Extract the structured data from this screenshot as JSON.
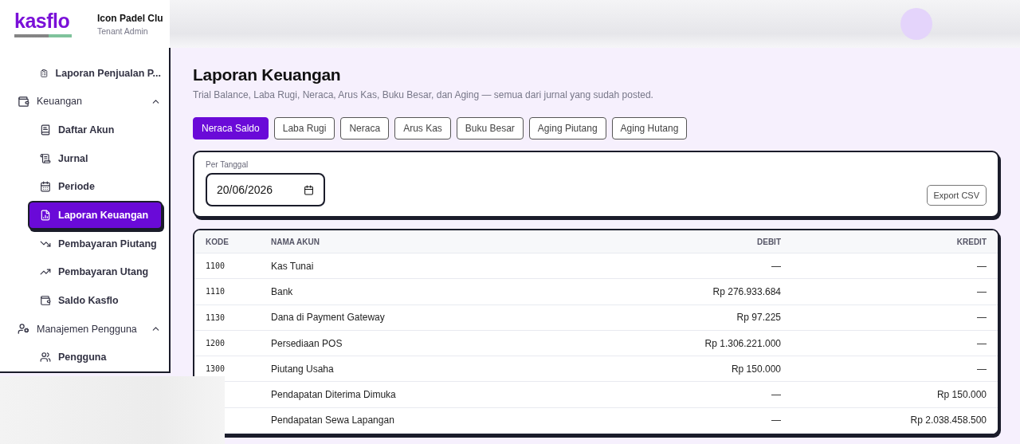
{
  "header": {
    "logo": "kasflo",
    "tenant_name": "Icon Padel Clu",
    "role": "Tenant Admin"
  },
  "sidebar": {
    "items": [
      {
        "kind": "item",
        "label": "Laporan Penjualan P...",
        "selected": false
      },
      {
        "kind": "group",
        "label": "Keuangan",
        "expanded": true
      },
      {
        "kind": "item",
        "label": "Daftar Akun",
        "selected": false
      },
      {
        "kind": "item",
        "label": "Jurnal",
        "selected": false
      },
      {
        "kind": "item",
        "label": "Periode",
        "selected": false
      },
      {
        "kind": "item",
        "label": "Laporan Keuangan",
        "selected": true
      },
      {
        "kind": "item",
        "label": "Pembayaran Piutang",
        "selected": false
      },
      {
        "kind": "item",
        "label": "Pembayaran Utang",
        "selected": false
      },
      {
        "kind": "item",
        "label": "Saldo Kasflo",
        "selected": false
      },
      {
        "kind": "group",
        "label": "Manajemen Pengguna",
        "expanded": true
      },
      {
        "kind": "item",
        "label": "Pengguna",
        "selected": false
      }
    ]
  },
  "page": {
    "title": "Laporan Keuangan",
    "subtitle": "Trial Balance, Laba Rugi, Neraca, Arus Kas, Buku Besar, dan Aging — semua dari jurnal yang sudah posted."
  },
  "tabs": [
    {
      "label": "Neraca Saldo",
      "selected": true
    },
    {
      "label": "Laba Rugi",
      "selected": false
    },
    {
      "label": "Neraca",
      "selected": false
    },
    {
      "label": "Arus Kas",
      "selected": false
    },
    {
      "label": "Buku Besar",
      "selected": false
    },
    {
      "label": "Aging Piutang",
      "selected": false
    },
    {
      "label": "Aging Hutang",
      "selected": false
    }
  ],
  "filter": {
    "label": "Per Tanggal",
    "value": "20/06/2026",
    "export_button": "Export CSV"
  },
  "table": {
    "columns": [
      "KODE",
      "NAMA AKUN",
      "DEBIT",
      "KREDIT"
    ],
    "rows": [
      {
        "code": "1100",
        "name": "Kas Tunai",
        "debit": "—",
        "kredit": "—"
      },
      {
        "code": "1110",
        "name": "Bank",
        "debit": "Rp 276.933.684",
        "kredit": "—"
      },
      {
        "code": "1130",
        "name": "Dana di Payment Gateway",
        "debit": "Rp 97.225",
        "kredit": "—"
      },
      {
        "code": "1200",
        "name": "Persediaan POS",
        "debit": "Rp 1.306.221.000",
        "kredit": "—"
      },
      {
        "code": "1300",
        "name": "Piutang Usaha",
        "debit": "Rp 150.000",
        "kredit": "—"
      },
      {
        "name": "Pendapatan Diterima Dimuka",
        "debit": "—",
        "kredit": "Rp 150.000"
      },
      {
        "name": "Pendapatan Sewa Lapangan",
        "debit": "—",
        "kredit": "Rp 2.038.458.500"
      }
    ]
  }
}
